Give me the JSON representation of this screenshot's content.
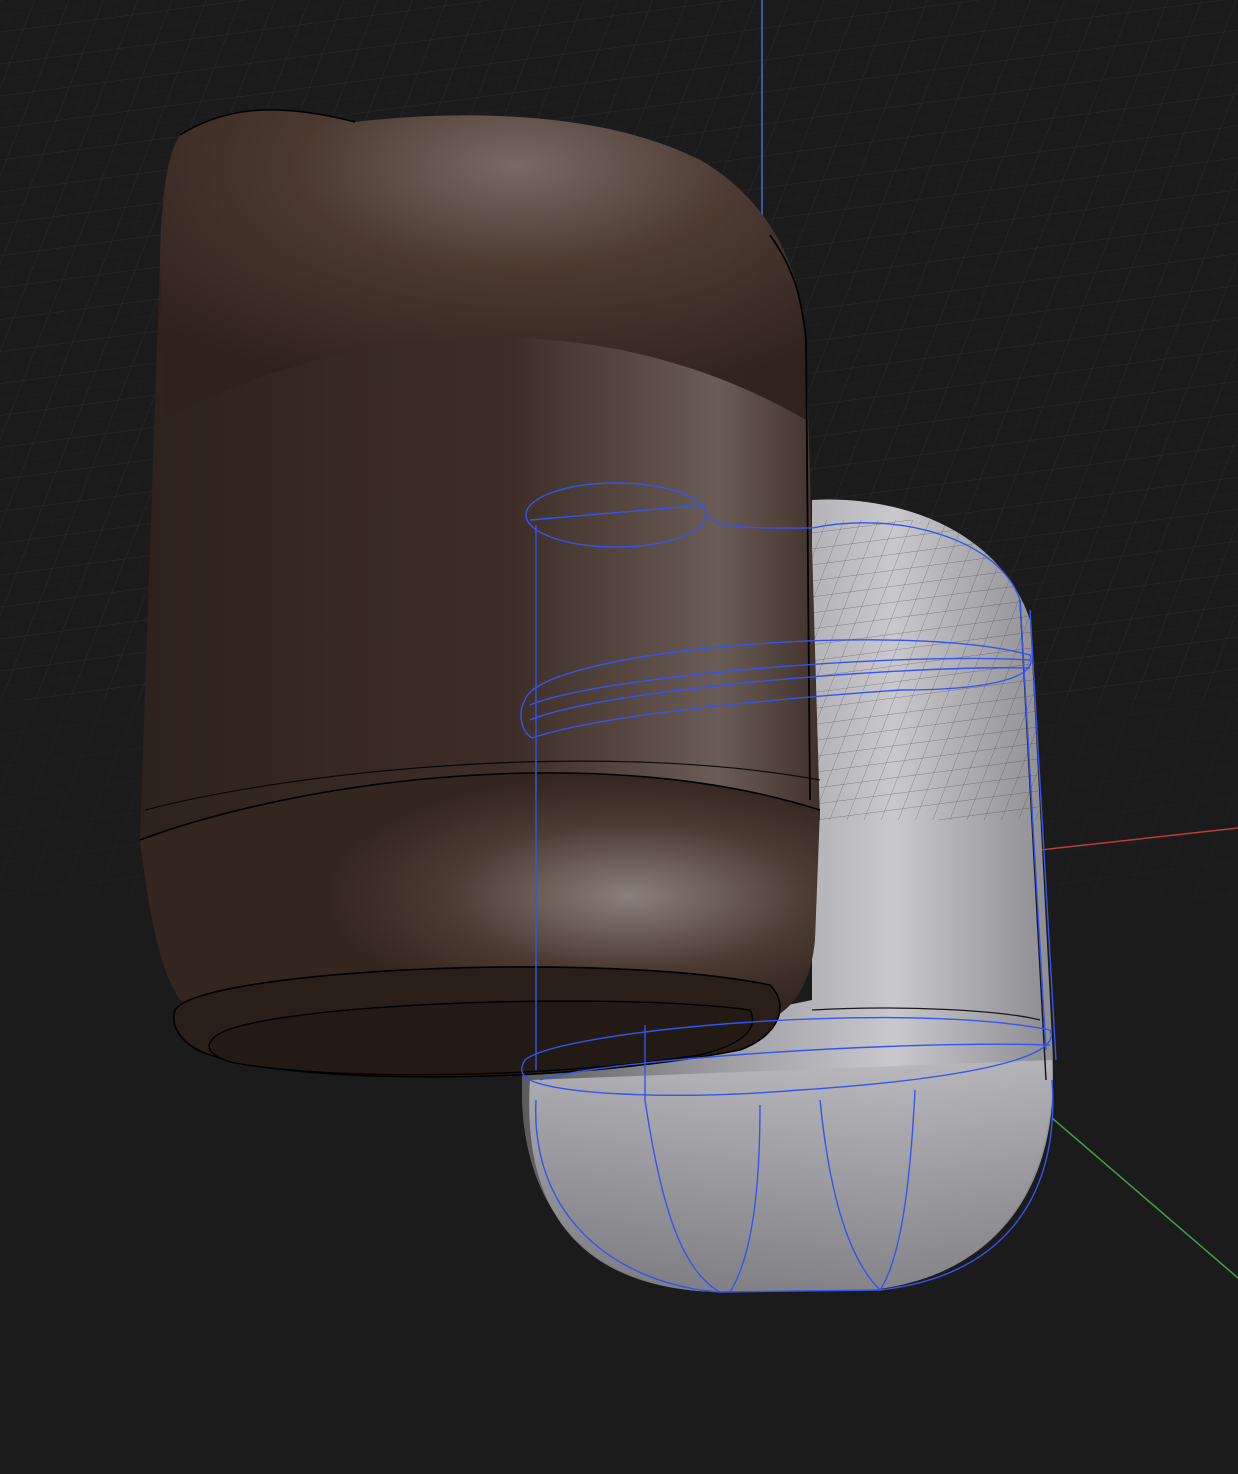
{
  "viewport": {
    "background": "#1b1b1c",
    "grid_color": "#2b2b2d",
    "axes": {
      "x_color": "#b8403a",
      "y_color": "#3fa048",
      "z_color": "#3c6fd0"
    }
  },
  "objects": [
    {
      "name": "brown-body",
      "base_color": "#3a2b24",
      "highlight_color": "#8d7f79",
      "edge_color": "#000000",
      "selected": false
    },
    {
      "name": "grey-capsule",
      "base_color": "#8a8a8e",
      "highlight_color": "#d2d2d6",
      "edge_color": "#101010",
      "selected": true,
      "selection_color": "#3355ee"
    }
  ]
}
